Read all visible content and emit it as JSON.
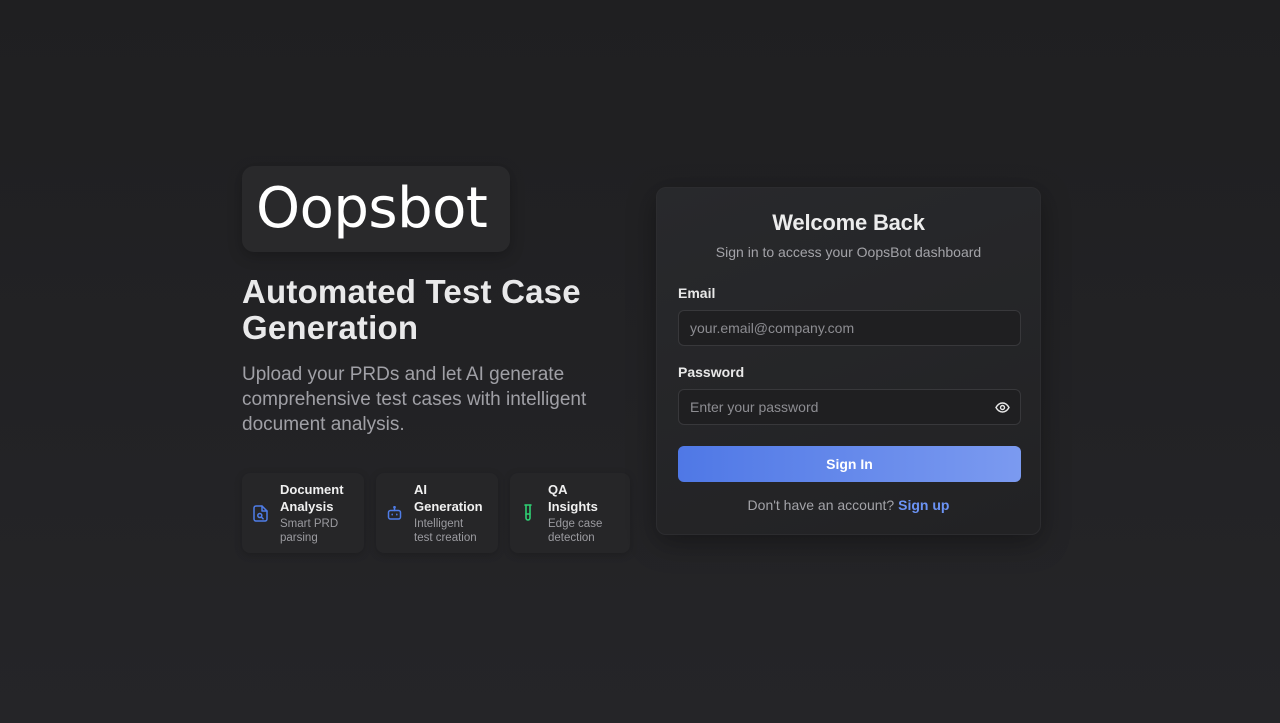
{
  "brand": {
    "logo_text": "Oopsbot"
  },
  "hero": {
    "headline": "Automated Test Case Generation",
    "description": "Upload your PRDs and let AI generate comprehensive test cases with intelligent document analysis."
  },
  "features": [
    {
      "icon": "document-search-icon",
      "title": "Document Analysis",
      "description": "Smart PRD parsing",
      "color": "#4f7de8"
    },
    {
      "icon": "robot-icon",
      "title": "AI Generation",
      "description": "Intelligent test creation",
      "color": "#4f7de8"
    },
    {
      "icon": "test-tube-icon",
      "title": "QA Insights",
      "description": "Edge case detection",
      "color": "#2fcf73"
    }
  ],
  "login": {
    "title": "Welcome Back",
    "subtitle": "Sign in to access your OopsBot dashboard",
    "email_label": "Email",
    "email_placeholder": "your.email@company.com",
    "email_value": "",
    "password_label": "Password",
    "password_placeholder": "Enter your password",
    "password_value": "",
    "password_toggle_icon": "eye-icon",
    "submit_label": "Sign In",
    "footer_text": "Don't have an account?",
    "signup_label": "Sign up"
  },
  "colors": {
    "accent": "#4f78e6",
    "accent_light": "#7b9af0",
    "link": "#6b93f5",
    "background": "#232326",
    "card": "#27282b"
  }
}
